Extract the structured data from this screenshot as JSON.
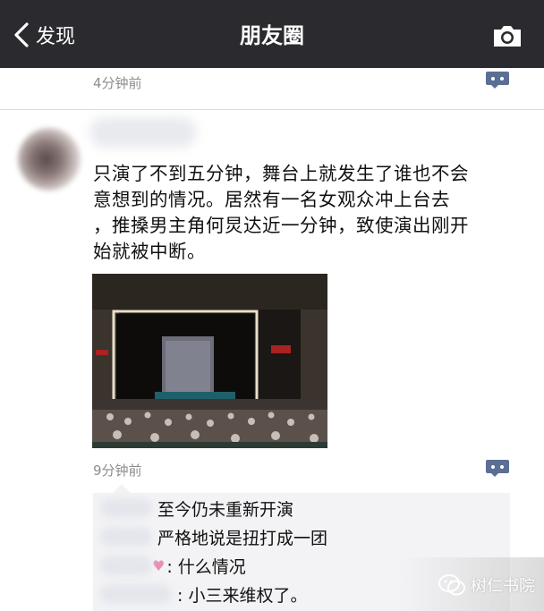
{
  "navbar": {
    "back_label": "发现",
    "title": "朋友圈",
    "icons": {
      "back": "chevron-left-icon",
      "camera": "camera-icon"
    }
  },
  "previous_post": {
    "time": "4分钟前"
  },
  "post": {
    "text_lines": [
      "只演了不到五分钟，舞台上就发生了谁也不会",
      "意想到的情况。居然有一名女观众冲上台去",
      "，推搡男主角何炅达近一分钟，致使演出刚开",
      "始就被中断。"
    ],
    "time": "9分钟前",
    "comments": [
      {
        "text": "至今仍未重新开演"
      },
      {
        "text": "严格地说是扭打成一团"
      },
      {
        "text": ": 什么情况"
      },
      {
        "text": ": 小三来维权了。"
      }
    ]
  },
  "watermark": {
    "text": "树仁书院"
  },
  "colors": {
    "navbar": "#2b2b2f",
    "comment_icon": "#5b6f94",
    "time_text": "#8d8d8d"
  }
}
